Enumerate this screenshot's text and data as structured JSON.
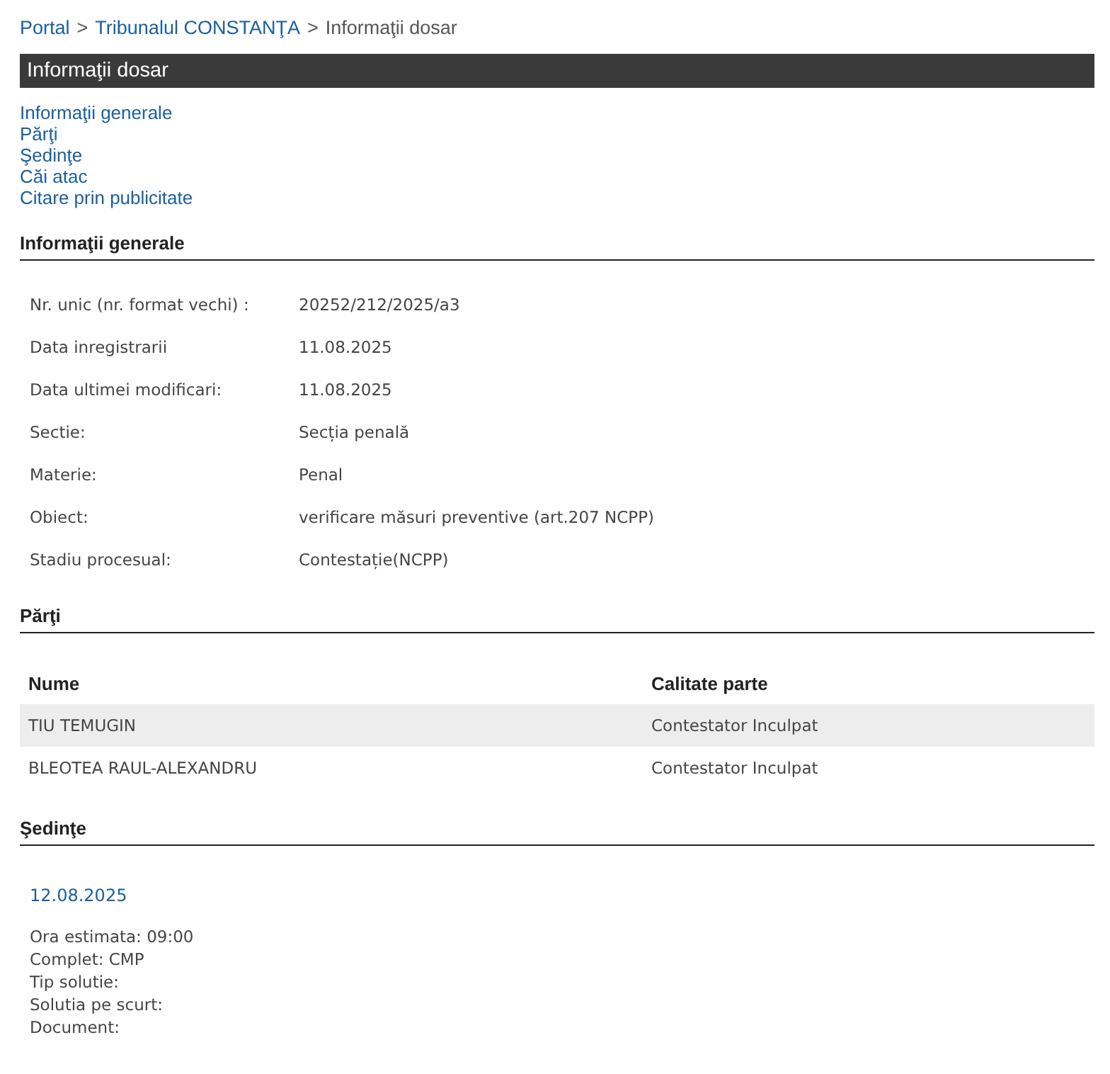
{
  "breadcrumb": [
    {
      "label": "Portal",
      "kind": "link"
    },
    {
      "separator": ">",
      "label": "Tribunalul CONSTANŢA",
      "kind": "link"
    },
    {
      "separator": ">",
      "label": "Informaţii dosar",
      "kind": "current"
    }
  ],
  "title_bar": "Informaţii dosar",
  "nav_links": [
    "Informaţii generale",
    "Părţi",
    "Şedinţe",
    "Căi atac",
    "Citare prin publicitate"
  ],
  "general": {
    "heading": "Informaţii generale",
    "fields": [
      {
        "label": "Nr. unic (nr. format vechi) :",
        "value": "20252/212/2025/a3"
      },
      {
        "label": "Data inregistrarii",
        "value": "11.08.2025"
      },
      {
        "label": "Data ultimei modificari:",
        "value": "11.08.2025"
      },
      {
        "label": "Sectie:",
        "value": "Secția penală"
      },
      {
        "label": "Materie:",
        "value": "Penal"
      },
      {
        "label": "Obiect:",
        "value": "verificare măsuri preventive (art.207 NCPP)"
      },
      {
        "label": "Stadiu procesual:",
        "value": "Contestație(NCPP)"
      }
    ]
  },
  "parties": {
    "heading": "Părţi",
    "columns": [
      "Nume",
      "Calitate parte"
    ],
    "rows": [
      {
        "name": "TIU TEMUGIN",
        "role": "Contestator Inculpat"
      },
      {
        "name": "BLEOTEA RAUL-ALEXANDRU",
        "role": "Contestator Inculpat"
      }
    ]
  },
  "hearings": {
    "heading": "Şedinţe",
    "items": [
      {
        "date": "12.08.2025",
        "details": [
          "Ora estimata: 09:00",
          "Complet: CMP",
          "Tip solutie:",
          "Solutia pe scurt:",
          "Document:"
        ]
      }
    ]
  }
}
